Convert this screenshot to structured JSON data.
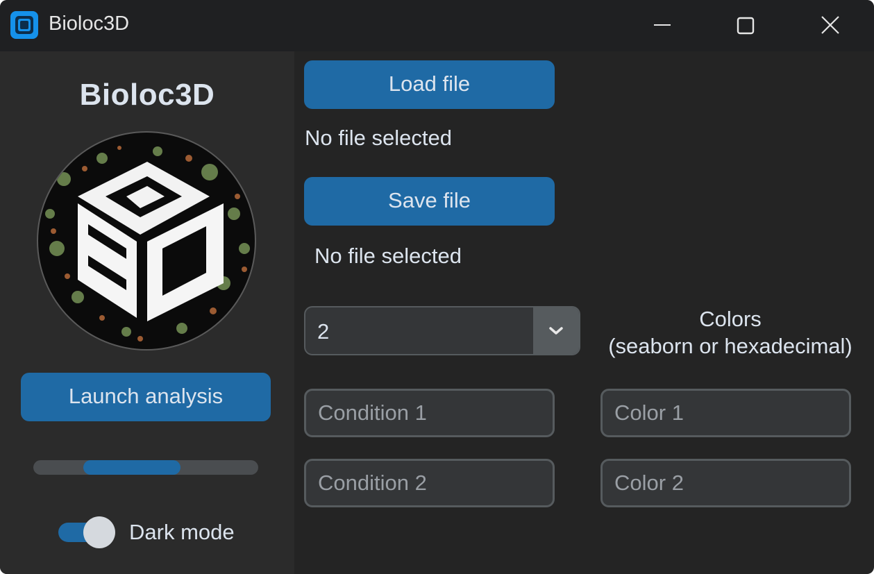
{
  "window": {
    "title": "Bioloc3D",
    "controls": {
      "minimize_icon": "minimize-icon",
      "maximize_icon": "maximize-icon",
      "close_icon": "close-icon"
    }
  },
  "sidebar": {
    "title": "Bioloc3D",
    "logo_icon": "bioloc3d-logo",
    "launch_button": "Launch analysis",
    "progress": 0.43,
    "dark_mode_label": "Dark mode",
    "dark_mode_on": true
  },
  "main": {
    "load_button": "Load file",
    "load_status": "No file selected",
    "save_button": "Save file",
    "save_status": "No file selected",
    "conditions_count": "2",
    "colors_label_line1": "Colors",
    "colors_label_line2": "(seaborn or hexadecimal)",
    "condition_1_placeholder": "Condition 1",
    "condition_2_placeholder": "Condition 2",
    "color_1_placeholder": "Color 1",
    "color_2_placeholder": "Color 2"
  },
  "colors": {
    "accent": "#1f6aa5",
    "background": "#242424",
    "sidebar": "#2b2b2b",
    "titlebar": "#1f2022",
    "text": "#dce4ee"
  }
}
